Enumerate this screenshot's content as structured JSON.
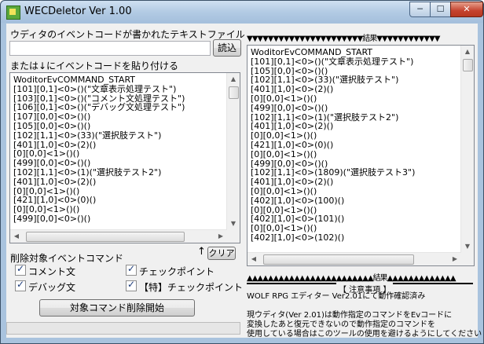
{
  "window": {
    "title": "WECDeletor   Ver 1.00",
    "controls": {
      "minimize": "─",
      "maximize": "☐",
      "close": "✕"
    }
  },
  "input_section": {
    "file_label": "ウディタのイベントコードが書かれたテキストファイル",
    "file_path": "",
    "read_button": "読込",
    "paste_label": "または↓にイベントコードを貼り付ける",
    "source_lines": [
      "WoditorEvCOMMAND_START",
      "[101][0,1]<0>()(\"文章表示処理テスト\")",
      "[103][0,1]<0>()(\"コメント文処理テスト\")",
      "[106][0,1]<0>()(\"デバッグ文処理テスト\")",
      "[107][0,0]<0>()()",
      "[105][0,0]<0>()()",
      "[102][1,1]<0>(33)(\"選択肢テスト\")",
      "[401][1,0]<0>(2)()",
      "[0][0,0]<1>()()",
      "[499][0,0]<0>()()",
      "[102][1,1]<0>(1)(\"選択肢テスト2\")",
      "[401][1,0]<0>(2)()",
      "[0][0,0]<1>()()",
      "[421][1,0]<0>(0)()",
      "[0][0,0]<1>()()",
      "[499][0,0]<0>()()"
    ],
    "up_arrow": "↑",
    "clear_button": "クリア"
  },
  "delete_section": {
    "label": "削除対象イベントコマンド",
    "checkboxes": [
      {
        "label": "コメント文",
        "checked": true
      },
      {
        "label": "チェックポイント",
        "checked": true
      },
      {
        "label": "デバッグ文",
        "checked": true
      },
      {
        "label": "【特】チェックポイント",
        "checked": true
      }
    ],
    "start_button": "対象コマンド削除開始",
    "progress": 0
  },
  "result_section": {
    "header_banner": "▼▼▼▼▼▼▼▼▼▼▼▼▼▼▼▼▼▼▼▼▼▼結果▼▼▼▼▼▼▼▼▼▼▼▼",
    "result_lines": [
      "WoditorEvCOMMAND_START",
      "[101][0,1]<0>()(\"文章表示処理テスト\")",
      "[105][0,0]<0>()()",
      "[102][1,1]<0>(33)(\"選択肢テスト\")",
      "[401][1,0]<0>(2)()",
      "[0][0,0]<1>()()",
      "[499][0,0]<0>()()",
      "[102][1,1]<0>(1)(\"選択肢テスト2\")",
      "[401][1,0]<0>(2)()",
      "[0][0,0]<1>()()",
      "[421][1,0]<0>(0)()",
      "[0][0,0]<1>()()",
      "[499][0,0]<0>()()",
      "[102][1,1]<0>(1809)(\"選択肢テスト3\")",
      "[401][1,0]<0>(2)()",
      "[0][0,0]<1>()()",
      "[402][1,0]<0>(100)()",
      "[0][0,0]<1>()()",
      "[402][1,0]<0>(101)()",
      "[0][0,0]<1>()()",
      "[402][1,0]<0>(102)()"
    ],
    "footer_banner": "▲▲▲▲▲▲▲▲▲▲▲▲▲▲▲▲▲▲▲▲▲▲▲▲結果▲▲▲▲▲▲▲▲▲▲▲▲▲",
    "notice_title": "【 注意事項 】",
    "notice_lines": [
      "WOLF RPG エディター Ver2.01にて動作確認済み",
      "",
      "現ウディタ(Ver 2.01)は動作指定のコマンドをEvコードに",
      "変換したあと復元できないので動作指定のコマンドを",
      "使用している場合はこのツールの使用を避けるようにしてください"
    ]
  },
  "colors": {
    "title_bar": "#b3cbe4",
    "client_bg": "#f0f0f0",
    "close_button": "#c4422e",
    "check_mark": "#1c3b7a"
  }
}
